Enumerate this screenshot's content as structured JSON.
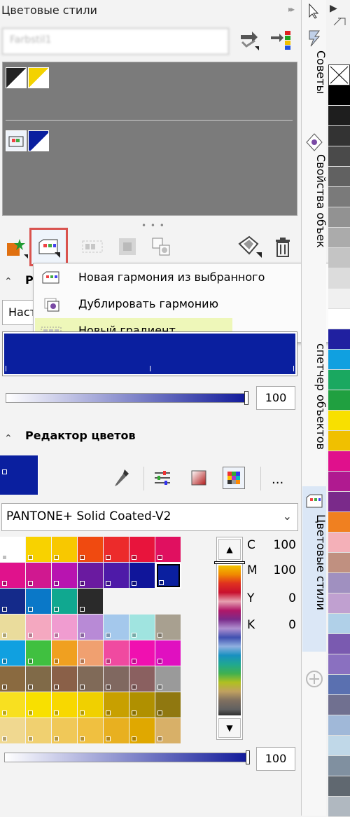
{
  "panel": {
    "title": "Цветовые стили",
    "name_field_value": "Farbstil1",
    "close_label": "✕",
    "collapse_label": "▸▸"
  },
  "right_tabs": {
    "tips": "Советы",
    "object_properties": "Свойства объек",
    "object_manager": "спетчер объектов",
    "color_styles": "Цветовые стили"
  },
  "context_menu": {
    "items": [
      {
        "label": "Новая гармония из выбранного"
      },
      {
        "label": "Дублировать гармонию"
      },
      {
        "label": "Новый градиент"
      }
    ]
  },
  "harmony_section": {
    "title": "Р",
    "dropdown_value": "Наст"
  },
  "slider_top": {
    "value": "100"
  },
  "color_editor": {
    "title": "Редактор цветов",
    "more_label": "...",
    "palette_dropdown": "PANTONE+ Solid Coated-V2",
    "cmyk": [
      {
        "label": "C",
        "value": "100"
      },
      {
        "label": "M",
        "value": "100"
      },
      {
        "label": "Y",
        "value": "0"
      },
      {
        "label": "K",
        "value": "0"
      }
    ]
  },
  "slider_bottom": {
    "value": "100"
  },
  "colors": {
    "accent_blue": "#0a1f9f",
    "panel_gray": "#7b7b7b",
    "highlight": "#eef7b9",
    "red_outline": "#d9534f"
  }
}
